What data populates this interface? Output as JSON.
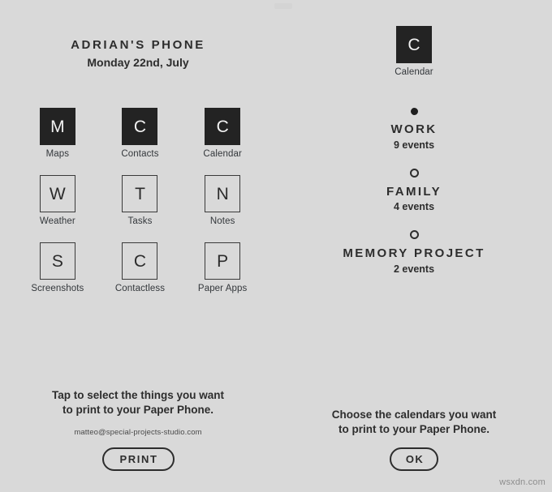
{
  "phone": {
    "title": "ADRIAN'S PHONE",
    "date": "Monday 22nd, July",
    "apps": [
      {
        "letter": "M",
        "label": "Maps",
        "style": "filled"
      },
      {
        "letter": "C",
        "label": "Contacts",
        "style": "filled"
      },
      {
        "letter": "C",
        "label": "Calendar",
        "style": "filled"
      },
      {
        "letter": "W",
        "label": "Weather",
        "style": "outline"
      },
      {
        "letter": "T",
        "label": "Tasks",
        "style": "outline"
      },
      {
        "letter": "N",
        "label": "Notes",
        "style": "outline"
      },
      {
        "letter": "S",
        "label": "Screenshots",
        "style": "outline"
      },
      {
        "letter": "C",
        "label": "Contactless",
        "style": "outline"
      },
      {
        "letter": "P",
        "label": "Paper Apps",
        "style": "outline"
      }
    ],
    "instruction_line1": "Tap to select the things you want",
    "instruction_line2": "to print to your Paper Phone.",
    "email": "matteo@special-projects-studio.com",
    "print_button": "PRINT"
  },
  "calendar": {
    "app_letter": "C",
    "app_label": "Calendar",
    "items": [
      {
        "name": "WORK",
        "count": "9 events",
        "selected": true
      },
      {
        "name": "FAMILY",
        "count": "4 events",
        "selected": false
      },
      {
        "name": "MEMORY PROJECT",
        "count": "2 events",
        "selected": false
      }
    ],
    "instruction_line1": "Choose the calendars you want",
    "instruction_line2": "to print to your Paper Phone.",
    "ok_button": "OK"
  },
  "watermark": "wsxdn.com",
  "colors": {
    "background": "#d9d9d9",
    "ink": "#2d2d2d",
    "tile_fill": "#232323",
    "tile_text": "#f2f2f2"
  }
}
